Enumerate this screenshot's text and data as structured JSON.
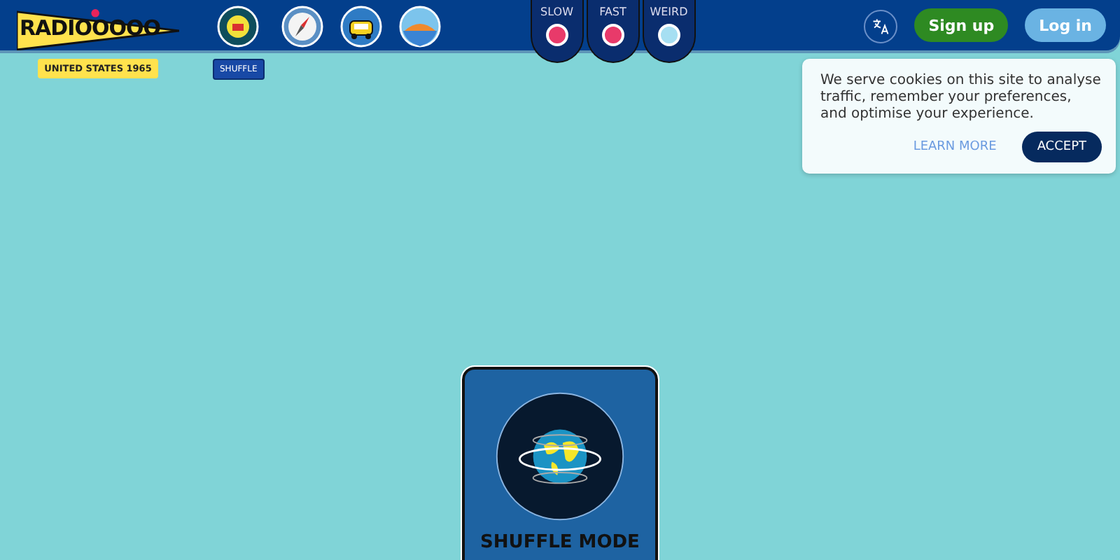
{
  "header": {
    "logo": "RADIOOOOO",
    "country_decade": "UNITED STATES 1965",
    "shuffle_label": "SHUFFLE",
    "modes": [
      {
        "label": "SLOW",
        "on": true
      },
      {
        "label": "FAST",
        "on": true
      },
      {
        "label": "WEIRD",
        "on": false
      }
    ],
    "signup": "Sign up",
    "login": "Log in"
  },
  "cookie_banner": {
    "text": "We serve cookies on this site to analyse traffic, remember your preferences, and optimise your experience.",
    "learn_more": "LEARN MORE",
    "accept": "ACCEPT"
  },
  "shuffle_card": {
    "title": "SHUFFLE MODE"
  }
}
